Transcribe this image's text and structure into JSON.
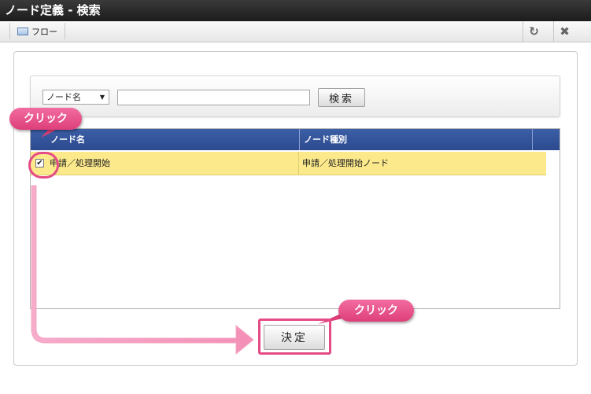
{
  "window": {
    "title": "ノード定義 - 検索"
  },
  "toolbar": {
    "flow_label": "フロー",
    "flow_icon": "window-icon",
    "refresh_icon": "↻",
    "close_icon": "✖"
  },
  "search": {
    "select_value": "ノード名",
    "input_value": "",
    "button_label": "検索"
  },
  "grid": {
    "headers": [
      "ノード名",
      "ノード種別"
    ],
    "rows": [
      {
        "checked": true,
        "node_name": "申請／処理開始",
        "node_type": "申請／処理開始ノード"
      }
    ]
  },
  "actions": {
    "ok_label": "決定"
  },
  "annotations": {
    "callout_check": "クリック",
    "callout_ok": "クリック",
    "accent_color": "#e54b86"
  }
}
